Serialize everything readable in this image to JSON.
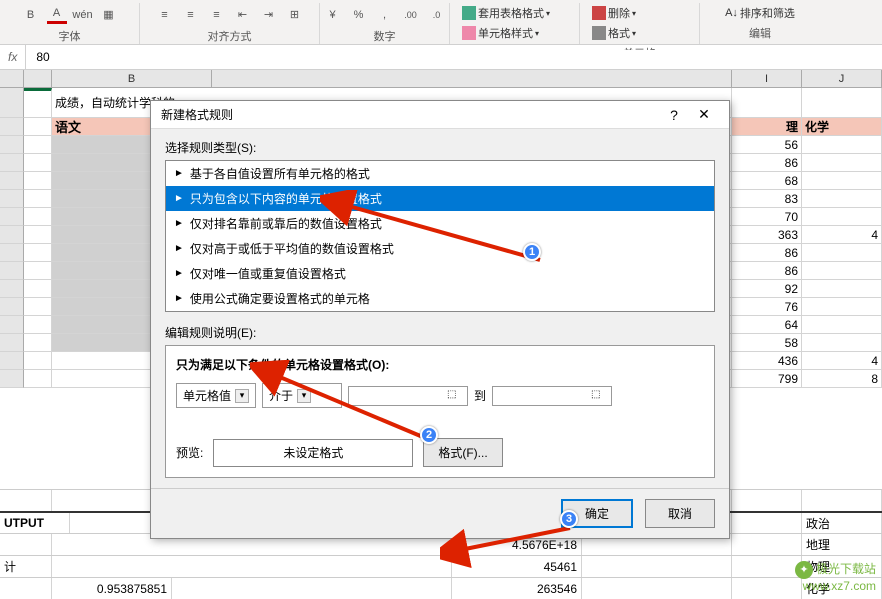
{
  "ribbon": {
    "group_font": "字体",
    "group_align": "对齐方式",
    "group_number": "数字",
    "group_cells": "单元格",
    "group_editing": "编辑",
    "pinyin_label": "wén",
    "table_format": "套用表格格式",
    "cell_style": "单元格样式",
    "delete": "删除",
    "format": "格式",
    "sort_filter": "排序和筛选",
    "accounting": "%",
    "decimals_inc": ".00",
    "decimals_dec": ".0"
  },
  "formula_bar": {
    "fx": "fx",
    "value": "80"
  },
  "columns": {
    "B": "B",
    "I": "I",
    "J": "J"
  },
  "sheet": {
    "topic": "成绩，自动统计学科的",
    "header_b": "语文",
    "header_i": "理",
    "header_j": "化学",
    "col_i_values": [
      56,
      86,
      68,
      83,
      70,
      363,
      86,
      86,
      92,
      76,
      64,
      58,
      436,
      799
    ],
    "col_j_values": [
      "",
      "",
      "",
      "",
      "",
      4,
      "",
      "",
      "",
      "",
      "",
      "",
      4,
      8
    ]
  },
  "bottom": {
    "utput": "UTPUT",
    "stat": "计",
    "num": "0.953875851",
    "sci": "4.5676E+18",
    "val": "45461",
    "val2": "263546",
    "politics": "政治",
    "geography": "地理",
    "physics": "物理",
    "chemistry": "化学"
  },
  "dialog": {
    "title": "新建格式规则",
    "select_label": "选择规则类型(S):",
    "rules": [
      "基于各自值设置所有单元格的格式",
      "只为包含以下内容的单元格设置格式",
      "仅对排名靠前或靠后的数值设置格式",
      "仅对高于或低于平均值的数值设置格式",
      "仅对唯一值或重复值设置格式",
      "使用公式确定要设置格式的单元格"
    ],
    "edit_label": "编辑规则说明(E):",
    "edit_title": "只为满足以下条件的单元格设置格式(O):",
    "combo1": "单元格值",
    "combo2": "介于",
    "range_to": "到",
    "preview_label": "预览:",
    "preview_text": "未设定格式",
    "format_btn": "格式(F)...",
    "ok": "确定",
    "cancel": "取消"
  },
  "watermark": {
    "brand": "极光下载站",
    "url": "www.xz7.com"
  },
  "chart_data": null
}
